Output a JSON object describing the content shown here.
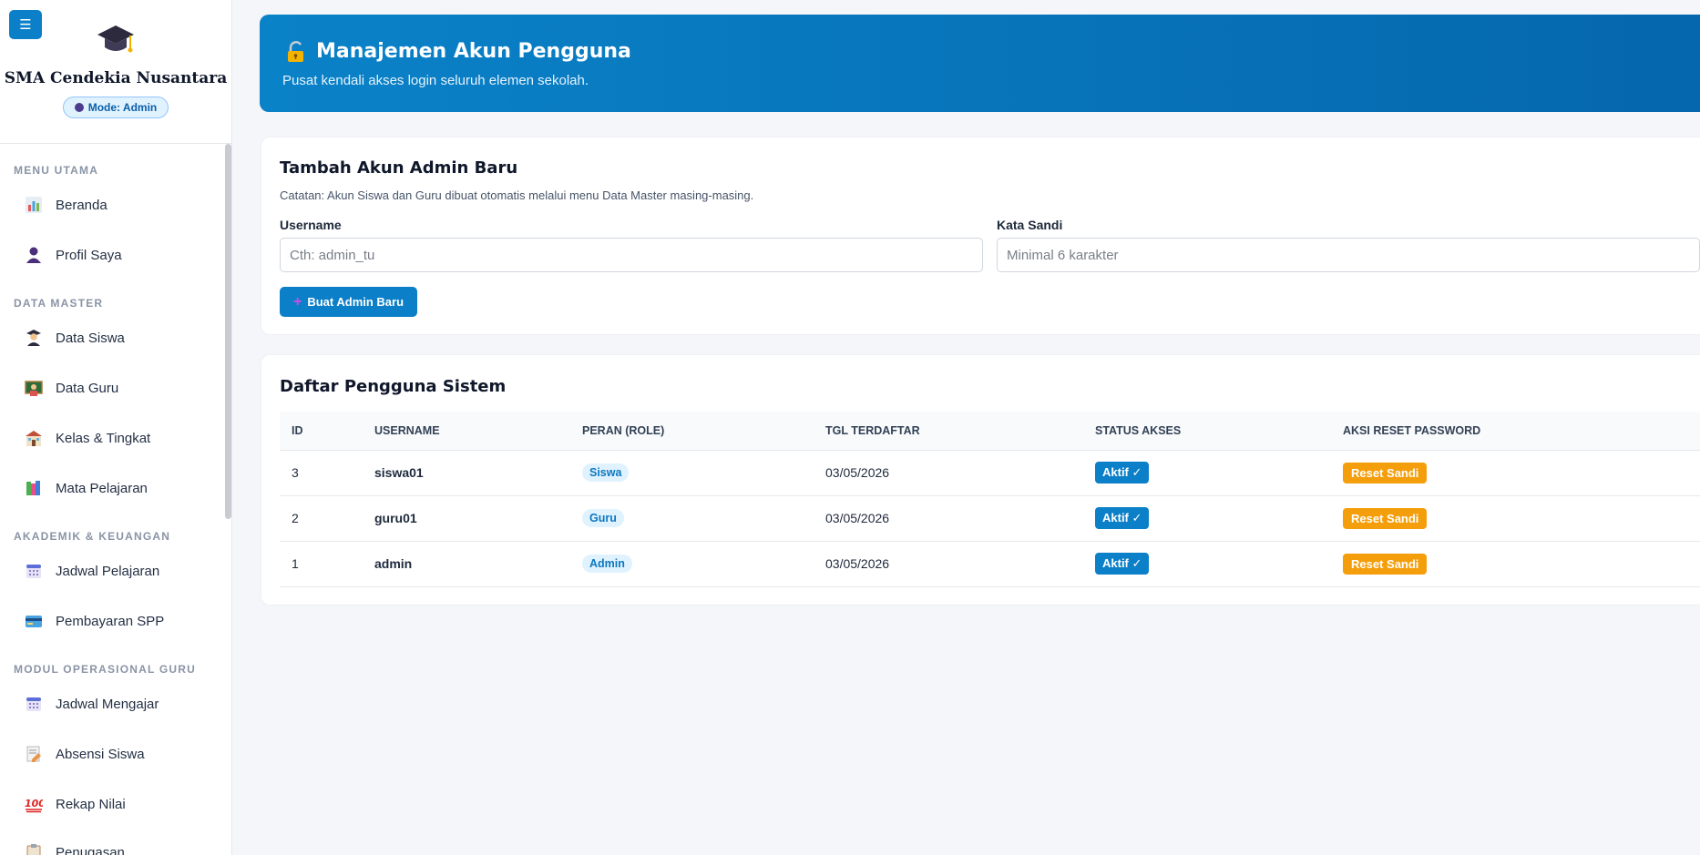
{
  "sidebar": {
    "toggle_glyph": "☰",
    "school_name": "SMA Cendekia Nusantara",
    "mode_label": "Mode: Admin",
    "sections": [
      {
        "title": "MENU UTAMA"
      },
      {
        "title": "DATA MASTER"
      },
      {
        "title": "AKADEMIK & KEUANGAN"
      },
      {
        "title": "MODUL OPERASIONAL GURU"
      }
    ],
    "items": [
      {
        "label": "Beranda",
        "icon": "bar-chart-icon"
      },
      {
        "label": "Profil Saya",
        "icon": "person-icon"
      },
      {
        "label": "Data Siswa",
        "icon": "student-icon"
      },
      {
        "label": "Data Guru",
        "icon": "teacher-icon"
      },
      {
        "label": "Kelas & Tingkat",
        "icon": "school-icon"
      },
      {
        "label": "Mata Pelajaran",
        "icon": "books-icon"
      },
      {
        "label": "Jadwal Pelajaran",
        "icon": "calendar-icon"
      },
      {
        "label": "Pembayaran SPP",
        "icon": "credit-card-icon"
      },
      {
        "label": "Jadwal Mengajar",
        "icon": "calendar-icon"
      },
      {
        "label": "Absensi Siswa",
        "icon": "memo-icon"
      },
      {
        "label": "Rekap Nilai",
        "icon": "hundred-points-icon"
      },
      {
        "label": "Penugasan",
        "icon": "clipboard-icon"
      }
    ]
  },
  "header": {
    "title": "Manajemen Akun Pengguna",
    "subtitle": "Pusat kendali akses login seluruh elemen sekolah."
  },
  "form": {
    "title": "Tambah Akun Admin Baru",
    "note": "Catatan: Akun Siswa dan Guru dibuat otomatis melalui menu Data Master masing-masing.",
    "username_label": "Username",
    "username_placeholder": "Cth: admin_tu",
    "password_label": "Kata Sandi",
    "password_placeholder": "Minimal 6 karakter",
    "submit_label": "Buat Admin Baru"
  },
  "users_table": {
    "title": "Daftar Pengguna Sistem",
    "columns": [
      "ID",
      "USERNAME",
      "PERAN (ROLE)",
      "TGL TERDAFTAR",
      "STATUS AKSES",
      "AKSI RESET PASSWORD"
    ],
    "rows": [
      {
        "id": "3",
        "username": "siswa01",
        "role": "Siswa",
        "date": "03/05/2026",
        "status": "Aktif ✓",
        "action": "Reset Sandi"
      },
      {
        "id": "2",
        "username": "guru01",
        "role": "Guru",
        "date": "03/05/2026",
        "status": "Aktif ✓",
        "action": "Reset Sandi"
      },
      {
        "id": "1",
        "username": "admin",
        "role": "Admin",
        "date": "03/05/2026",
        "status": "Aktif ✓",
        "action": "Reset Sandi"
      }
    ]
  },
  "colors": {
    "primary": "#0b7fc8",
    "warning": "#f59e0b",
    "role_badge_bg": "#e0f2fe"
  }
}
